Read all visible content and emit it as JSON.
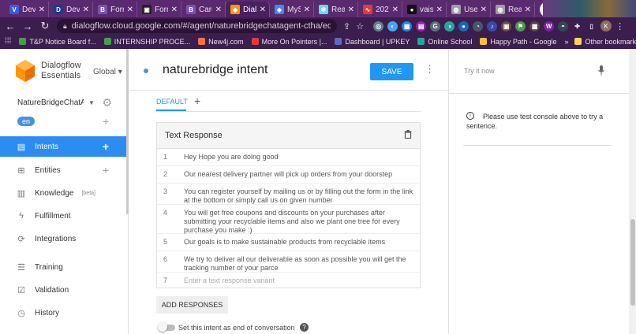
{
  "browser": {
    "tabs": [
      {
        "label": "Dev",
        "icon": "vee-icon",
        "color": "#3b5bdb",
        "glyph": "V"
      },
      {
        "label": "Dev",
        "icon": "dev-icon",
        "color": "#1e3a8a",
        "glyph": "D"
      },
      {
        "label": "Forr",
        "icon": "bootstrap-icon",
        "color": "#7952b3",
        "glyph": "B"
      },
      {
        "label": "Forr",
        "icon": "doc-icon",
        "color": "#222222",
        "glyph": "▣"
      },
      {
        "label": "Carc",
        "icon": "bootstrap-icon",
        "color": "#7952b3",
        "glyph": "B"
      },
      {
        "label": "Dial",
        "icon": "dialogflow-icon",
        "color": "#ff9800",
        "glyph": "◆",
        "active": true
      },
      {
        "label": "MyS",
        "icon": "shield-icon",
        "color": "#4285f4",
        "glyph": "◈"
      },
      {
        "label": "Rea",
        "icon": "react-icon",
        "color": "#61dafb",
        "glyph": "✻"
      },
      {
        "label": "202",
        "icon": "chart-icon",
        "color": "#e53935",
        "glyph": "∿"
      },
      {
        "label": "vais",
        "icon": "github-icon",
        "color": "#111111",
        "glyph": "●"
      },
      {
        "label": "Use",
        "icon": "globe-icon",
        "color": "#9e9e9e",
        "glyph": "◍"
      },
      {
        "label": "Rea",
        "icon": "globe-icon",
        "color": "#9e9e9e",
        "glyph": "◍"
      }
    ],
    "url": "dialogflow.cloud.google.com/#/agent/naturebridgechatagent-ctha/editInte...",
    "profile_initial": "K",
    "bookmarks": [
      {
        "label": "T&P Notice Board f...",
        "color": "#43a047"
      },
      {
        "label": "INTERNSHIP PROCE...",
        "color": "#43a047"
      },
      {
        "label": "New4j.com",
        "color": "#ff7043"
      },
      {
        "label": "More On Pointers |...",
        "color": "#e53935"
      },
      {
        "label": "Dashboard | UPKEY",
        "color": "#5c6bc0"
      },
      {
        "label": "Online School",
        "color": "#26a69a"
      },
      {
        "label": "Happy Path - Google",
        "color": "#fbc02d"
      }
    ],
    "bookmarks_overflow": "»",
    "other_bookmarks": "Other bookmarks"
  },
  "sidebar": {
    "product_line1": "Dialogflow",
    "product_line2": "Essentials",
    "region": "Global",
    "agent_name": "NatureBridgeChatA...",
    "language": "en",
    "nav": [
      {
        "label": "Intents",
        "icon": "chat-icon",
        "active": true,
        "plus": true
      },
      {
        "label": "Entities",
        "icon": "entities-icon",
        "plus": true
      },
      {
        "label": "Knowledge",
        "icon": "book-icon",
        "beta": "[beta]"
      },
      {
        "label": "Fulfillment",
        "icon": "bolt-icon"
      },
      {
        "label": "Integrations",
        "icon": "integrations-icon"
      },
      {
        "label": "Training",
        "icon": "training-icon"
      },
      {
        "label": "Validation",
        "icon": "check-icon"
      },
      {
        "label": "History",
        "icon": "history-icon"
      }
    ]
  },
  "main": {
    "intent_title": "naturebridge intent",
    "save_label": "SAVE",
    "lang_tab": "DEFAULT",
    "response_card": {
      "title": "Text Response",
      "rows": [
        {
          "num": "1",
          "text": "Hey Hope you are doing good"
        },
        {
          "num": "2",
          "text": "Our nearest delivery partner will pick up orders from your doorstep"
        },
        {
          "num": "3",
          "text": "You can register yourself by mailing us or by filling out the form in the link at the bottom or simply call us on given number"
        },
        {
          "num": "4",
          "text": "You will get free coupons and discounts on your purchases after submitting your recyclable items and also we plant one tree for every purchase you make :)"
        },
        {
          "num": "5",
          "text": "Our goals is to make sustainable products from recyclable items"
        },
        {
          "num": "6",
          "text": "We try to deliver all our deliverable as soon as possible you will get the tracking number of your parce"
        }
      ],
      "placeholder_num": "7",
      "placeholder": "Enter a text response variant"
    },
    "add_responses": "ADD RESPONSES",
    "end_conversation_label": "Set this intent as end of conversation",
    "help_glyph": "?"
  },
  "test_panel": {
    "try_it_placeholder": "Try it now",
    "info_message": "Please use test console above to try a sentence."
  }
}
